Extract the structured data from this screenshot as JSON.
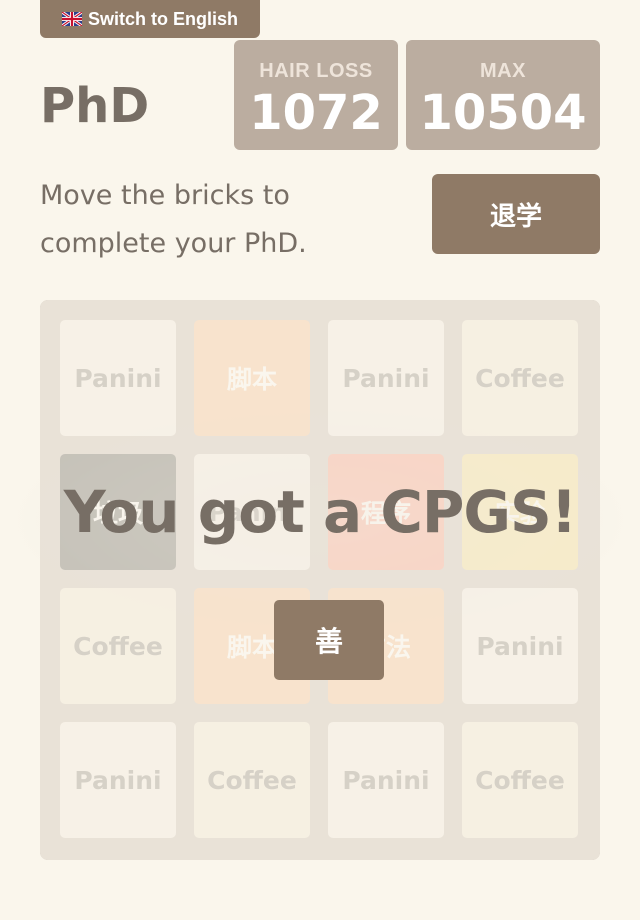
{
  "language_button": {
    "label": "Switch to English",
    "icon": "uk-flag-icon"
  },
  "header": {
    "title": "PhD",
    "scores": [
      {
        "label": "HAIR LOSS",
        "value": "1072"
      },
      {
        "label": "MAX",
        "value": "10504"
      }
    ],
    "intro": "Move the bricks to complete your PhD.",
    "quit_label": "退学"
  },
  "board": {
    "size": 4,
    "tiles": [
      [
        "Panini",
        "脚本",
        "Panini",
        "Coffee"
      ],
      [
        "垃圾",
        "Panini",
        "程序",
        "实验"
      ],
      [
        "Coffee",
        "脚本",
        "方法",
        "Panini"
      ],
      [
        "Panini",
        "Coffee",
        "Panini",
        "Coffee"
      ]
    ]
  },
  "game_message": {
    "text": "You got a CPGS!",
    "button_label": "善"
  },
  "colors": {
    "background": "#faf6ec",
    "board": "#bbada0",
    "button": "#8f7a66",
    "text": "#776e65"
  }
}
